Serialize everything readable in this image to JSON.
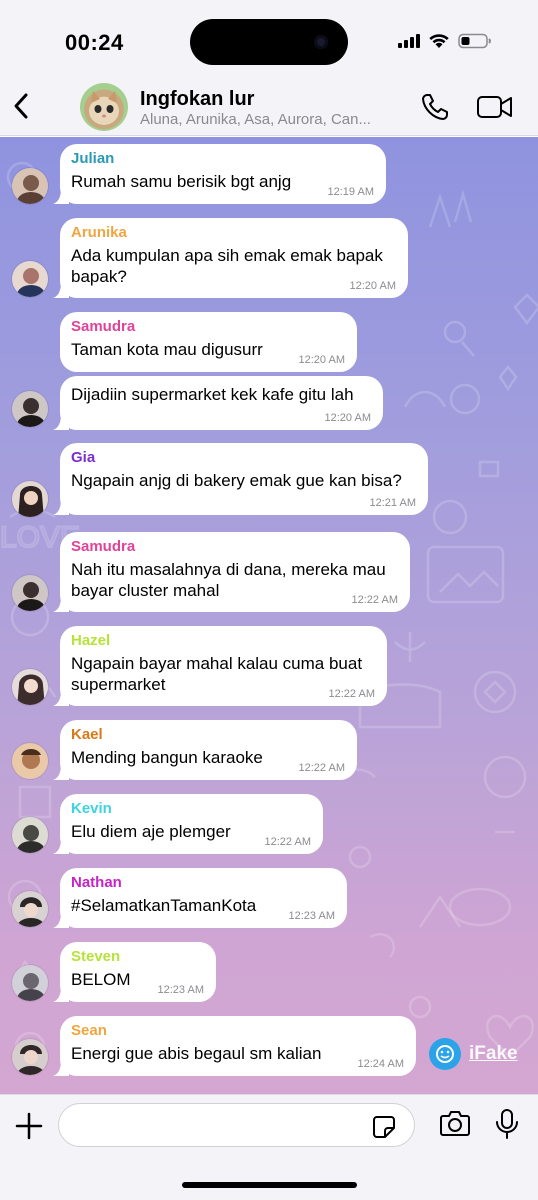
{
  "status_bar": {
    "time": "00:24"
  },
  "header": {
    "title": "Ingfokan lur",
    "subtitle": "Aluna, Arunika, Asa, Aurora, Can..."
  },
  "messages": [
    {
      "sender": "Julian",
      "sender_color": "#2a9bb5",
      "text": [
        "Rumah samu berisik bgt anjg"
      ],
      "time": "12:19 AM",
      "avatar_color": "#7a5a4a"
    },
    {
      "sender": "Arunika",
      "sender_color": "#f0a640",
      "text": [
        "Ada kumpulan apa sih emak emak bapak",
        "bapak?"
      ],
      "time": "12:20 AM",
      "avatar_color": "#a9746b"
    },
    {
      "sender": "Samudra",
      "sender_color": "#e0439a",
      "text": [
        "Taman kota mau digusurr"
      ],
      "time": "12:20 AM",
      "avatar_color": null
    },
    {
      "sender": "",
      "sender_color": "#e0439a",
      "text": [
        "Dijadiin supermarket kek kafe gitu lah"
      ],
      "time": "12:20 AM",
      "avatar_color": "#3a3030"
    },
    {
      "sender": "Gia",
      "sender_color": "#7b2fd0",
      "text": [
        "Ngapain anjg di bakery emak gue kan bisa?"
      ],
      "time": "12:21 AM",
      "avatar_color": "#2c2020"
    },
    {
      "sender": "Samudra",
      "sender_color": "#e0439a",
      "text": [
        "Nah itu masalahnya di dana, mereka mau",
        "bayar cluster mahal"
      ],
      "time": "12:22 AM",
      "avatar_color": "#3a3030"
    },
    {
      "sender": "Hazel",
      "sender_color": "#b7e23a",
      "text": [
        "Ngapain bayar mahal kalau cuma buat",
        "supermarket"
      ],
      "time": "12:22 AM",
      "avatar_color": "#3d2c2c"
    },
    {
      "sender": "Kael",
      "sender_color": "#d97a1a",
      "text": [
        "Mending bangun karaoke"
      ],
      "time": "12:22 AM",
      "avatar_color": "#b07850"
    },
    {
      "sender": "Kevin",
      "sender_color": "#3dd3e0",
      "text": [
        "Elu diem aje plemger"
      ],
      "time": "12:22 AM",
      "avatar_color": "#4a4a44"
    },
    {
      "sender": "Nathan",
      "sender_color": "#c724c7",
      "text": [
        "#SelamatkanTamanKota"
      ],
      "time": "12:23 AM",
      "avatar_color": "#2a2626"
    },
    {
      "sender": "Steven",
      "sender_color": "#b7e23a",
      "text": [
        "BELOM"
      ],
      "time": "12:23 AM",
      "avatar_color": "#6a6670"
    },
    {
      "sender": "Sean",
      "sender_color": "#f0a640",
      "text": [
        "Energi gue abis begaul sm kalian"
      ],
      "time": "12:24 AM",
      "avatar_color": "#302828"
    }
  ],
  "watermark": {
    "text": "iFake"
  },
  "input": {
    "value": ""
  },
  "icons": [
    "back-icon",
    "phone-icon",
    "video-camera-icon",
    "plus-icon",
    "sticker-icon",
    "camera-icon",
    "microphone-icon",
    "signal-icon",
    "wifi-icon",
    "battery-icon"
  ]
}
